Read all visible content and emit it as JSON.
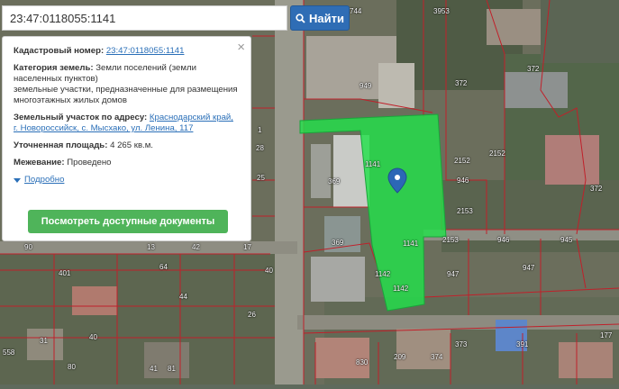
{
  "search": {
    "value": "23:47:0118055:1141",
    "button_label": "Найти"
  },
  "info": {
    "cadastral_label": "Кадастровый номер:",
    "cadastral_value": "23:47:0118055:1141",
    "category_label": "Категория земель:",
    "category_value": "Земли поселений (земли населенных пунктов)",
    "purpose_value": "земельные участки, предназначенные для размещения многоэтажных жилых домов",
    "address_label": "Земельный участок по адресу:",
    "address_value": "Краснодарский край, г. Новороссийск, с. Мысхако, ул. Ленина, 117",
    "area_label": "Уточненная площадь:",
    "area_value": "4 265 кв.м.",
    "survey_label": "Межевание:",
    "survey_value": "Проведено",
    "more_label": "Подробно",
    "docs_button": "Посмотреть доступные документы"
  },
  "parcel_labels": [
    "3953",
    "744",
    "372",
    "372",
    "949",
    "2152",
    "946",
    "2153",
    "946",
    "945",
    "2153",
    "947",
    "947",
    "1141",
    "1141",
    "369",
    "369",
    "1142",
    "1142",
    "2152",
    "372",
    "40",
    "42",
    "17",
    "401",
    "13",
    "44",
    "64",
    "26",
    "31",
    "40",
    "80",
    "41",
    "81",
    "830",
    "209",
    "374",
    "373",
    "391",
    "177",
    "558",
    "90",
    "28",
    "1",
    "25"
  ],
  "colors": {
    "parcel_fill": "#22e04a",
    "boundary": "#c0202a",
    "button_blue": "#2f6db5",
    "button_green": "#4fb45a",
    "link": "#2a6fb8"
  },
  "icons": {
    "search": "magnifier-icon",
    "close": "close-icon",
    "pin": "map-pin-icon",
    "expand": "triangle-down-icon"
  }
}
